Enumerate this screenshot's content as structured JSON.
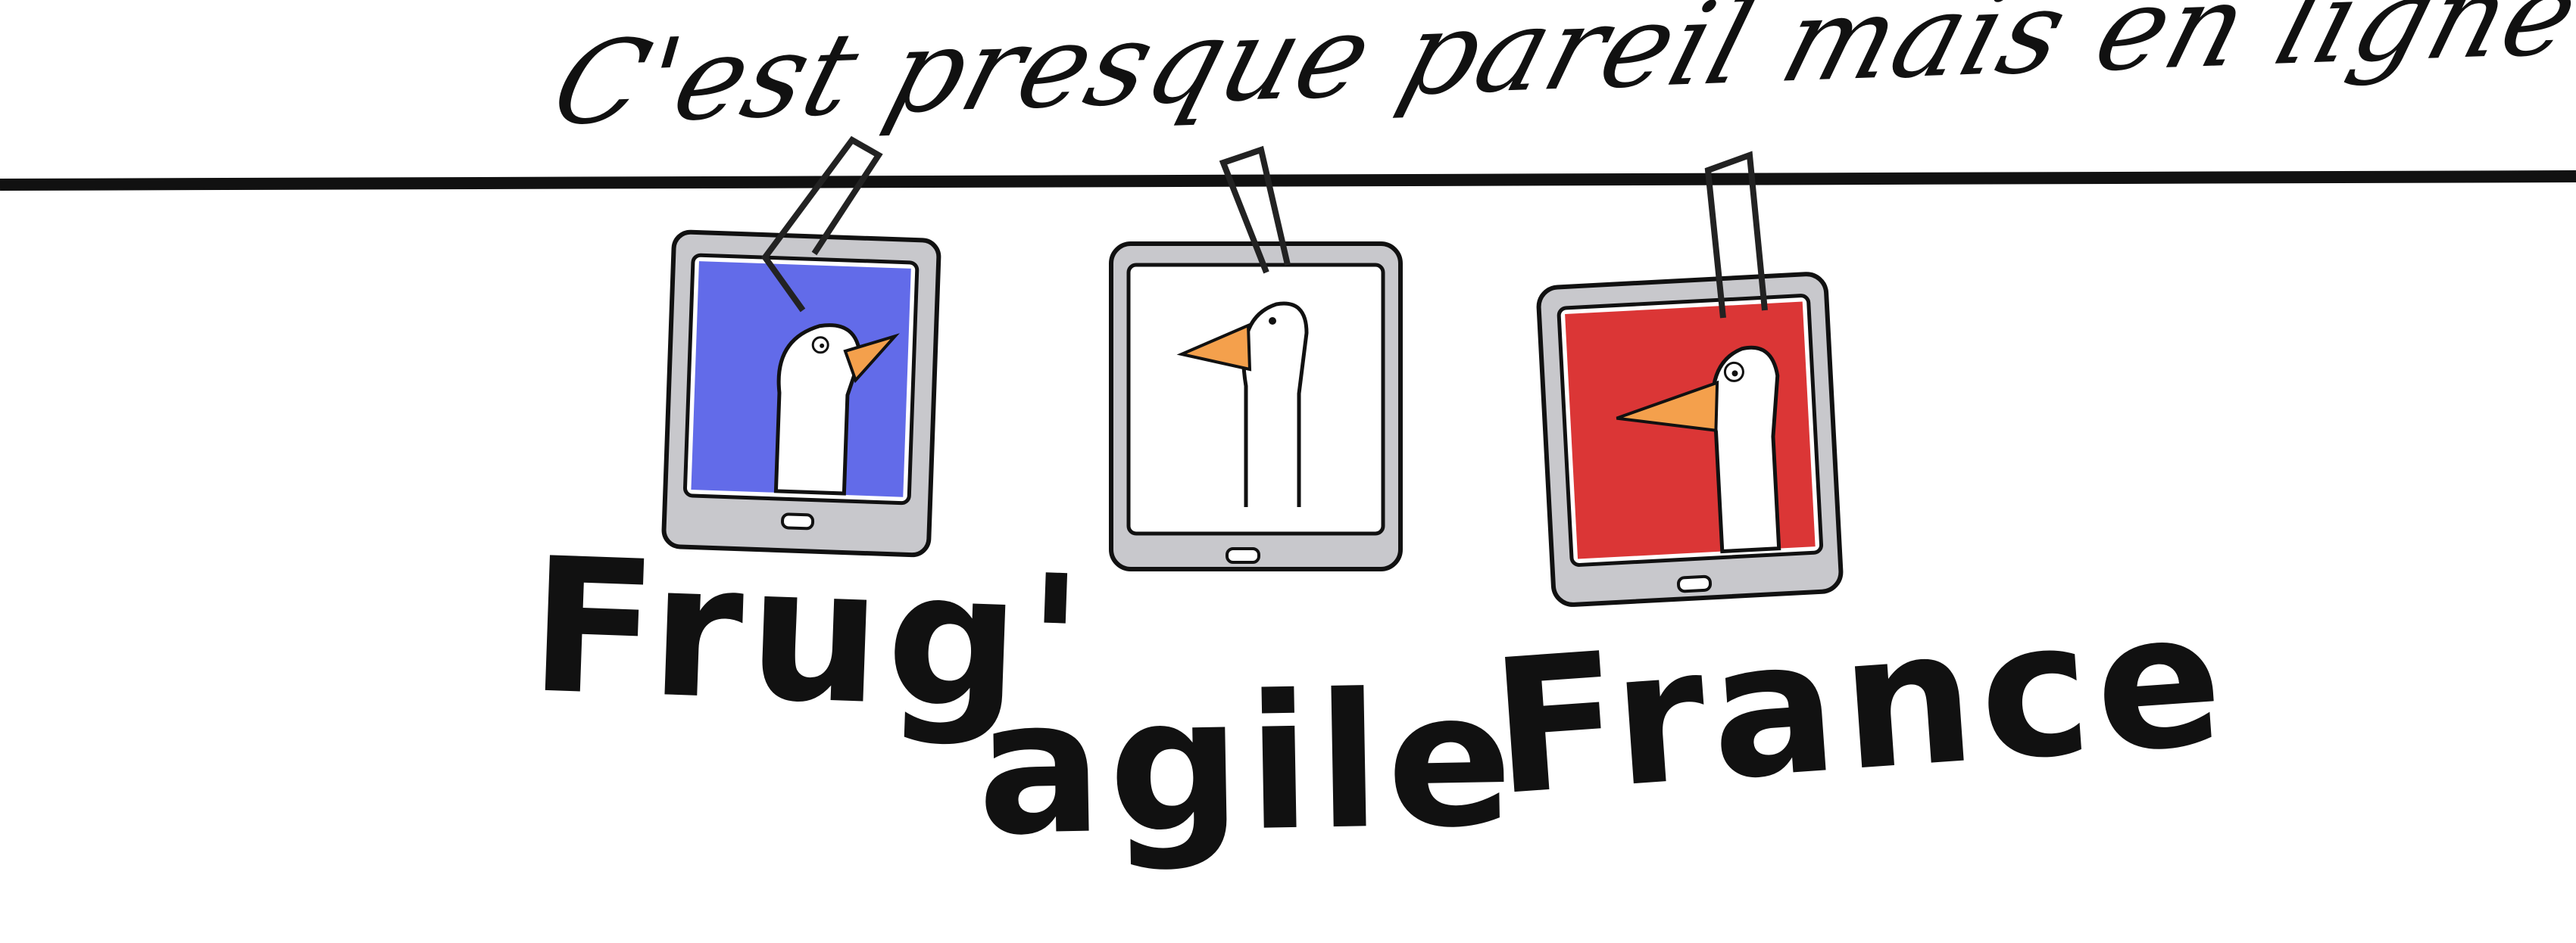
{
  "tagline": "C'est presque pareil mais en ligne",
  "title": {
    "part1": "Frug'",
    "part2": "agile",
    "part3": "France"
  },
  "icons": {
    "clothesline": "horizontal-line",
    "left_tablet": "tablet-blue-goose-icon",
    "middle_tablet": "tablet-white-goose-icon",
    "right_tablet": "tablet-red-goose-icon",
    "clip": "paperclip-icon"
  },
  "colors": {
    "blue": "#5a63e8",
    "white": "#ffffff",
    "red": "#d92b2b",
    "beak": "#f4a04c",
    "ink": "#111111",
    "tablet": "#c8c8cc"
  }
}
